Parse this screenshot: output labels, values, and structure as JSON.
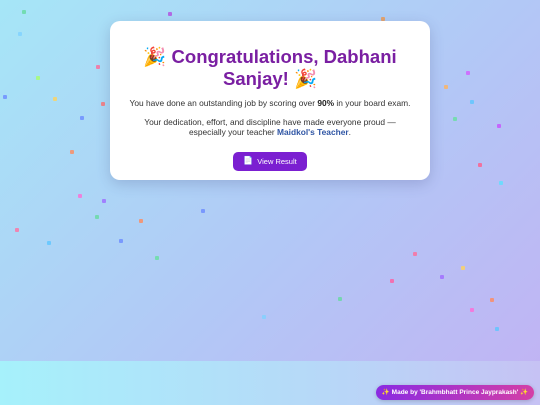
{
  "card": {
    "title_prefix_emoji": "🎉",
    "title": "Congratulations, Dabhani Sanjay!",
    "title_suffix_emoji": "🎉",
    "message_before": "You have done an outstanding job by scoring over ",
    "score": "90%",
    "message_after": " in your board exam.",
    "dedication_text": "Your dedication, effort, and discipline have made everyone proud — especially your teacher ",
    "teacher_name": "Maidkol's Teacher",
    "dedication_end": ".",
    "button_icon": "document-icon",
    "button_label": "View Result"
  },
  "credit": {
    "text": "✨ Made by 'Brahmbhatt Prince Jayprakash' ✨"
  },
  "colors": {
    "title": "#7a1fa2",
    "button": "#7b1fd1",
    "teacher_link": "#2f55a4"
  }
}
